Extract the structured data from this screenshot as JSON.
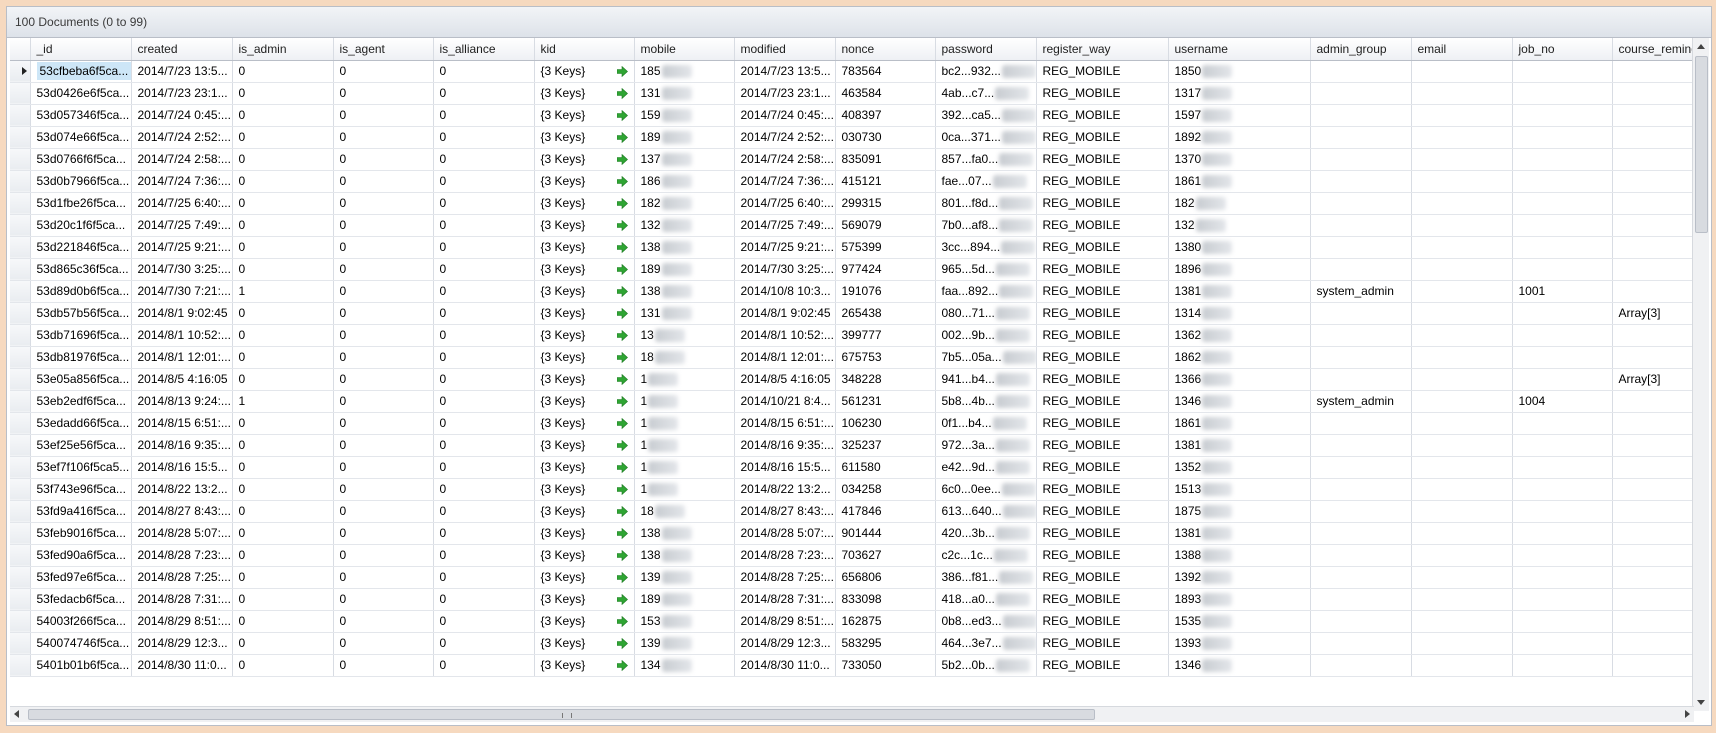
{
  "window": {
    "title": "100 Documents (0 to 99)"
  },
  "columns": [
    "_id",
    "created",
    "is_admin",
    "is_agent",
    "is_alliance",
    "kid",
    "mobile",
    "modified",
    "nonce",
    "password",
    "register_way",
    "username",
    "admin_group",
    "email",
    "job_no",
    "course_reminde"
  ],
  "rows": [
    {
      "id": "53cfbeba6f5ca...",
      "created": "2014/7/23 13:5...",
      "is_admin": "0",
      "is_agent": "0",
      "is_alliance": "0",
      "kid": "{3 Keys}",
      "mobile": "185",
      "modified": "2014/7/23 13:5...",
      "nonce": "783564",
      "password": "bc2...932...",
      "register_way": "REG_MOBILE",
      "username": "1850",
      "admin_group": "",
      "email": "",
      "job_no": "",
      "course_reminde": ""
    },
    {
      "id": "53d0426e6f5ca...",
      "created": "2014/7/23 23:1...",
      "is_admin": "0",
      "is_agent": "0",
      "is_alliance": "0",
      "kid": "{3 Keys}",
      "mobile": "131",
      "modified": "2014/7/23 23:1...",
      "nonce": "463584",
      "password": "4ab...c7...",
      "register_way": "REG_MOBILE",
      "username": "1317",
      "admin_group": "",
      "email": "",
      "job_no": "",
      "course_reminde": ""
    },
    {
      "id": "53d057346f5ca...",
      "created": "2014/7/24 0:45:...",
      "is_admin": "0",
      "is_agent": "0",
      "is_alliance": "0",
      "kid": "{3 Keys}",
      "mobile": "159",
      "modified": "2014/7/24 0:45:...",
      "nonce": "408397",
      "password": "392...ca5...",
      "register_way": "REG_MOBILE",
      "username": "1597",
      "admin_group": "",
      "email": "",
      "job_no": "",
      "course_reminde": ""
    },
    {
      "id": "53d074e66f5ca...",
      "created": "2014/7/24 2:52:...",
      "is_admin": "0",
      "is_agent": "0",
      "is_alliance": "0",
      "kid": "{3 Keys}",
      "mobile": "189",
      "modified": "2014/7/24 2:52:...",
      "nonce": "030730",
      "password": "0ca...371...",
      "register_way": "REG_MOBILE",
      "username": "1892",
      "admin_group": "",
      "email": "",
      "job_no": "",
      "course_reminde": ""
    },
    {
      "id": "53d0766f6f5ca...",
      "created": "2014/7/24 2:58:...",
      "is_admin": "0",
      "is_agent": "0",
      "is_alliance": "0",
      "kid": "{3 Keys}",
      "mobile": "137",
      "modified": "2014/7/24 2:58:...",
      "nonce": "835091",
      "password": "857...fa0...",
      "register_way": "REG_MOBILE",
      "username": "1370",
      "admin_group": "",
      "email": "",
      "job_no": "",
      "course_reminde": ""
    },
    {
      "id": "53d0b7966f5ca...",
      "created": "2014/7/24 7:36:...",
      "is_admin": "0",
      "is_agent": "0",
      "is_alliance": "0",
      "kid": "{3 Keys}",
      "mobile": "186",
      "modified": "2014/7/24 7:36:...",
      "nonce": "415121",
      "password": "fae...07...",
      "register_way": "REG_MOBILE",
      "username": "1861",
      "admin_group": "",
      "email": "",
      "job_no": "",
      "course_reminde": ""
    },
    {
      "id": "53d1fbe26f5ca...",
      "created": "2014/7/25 6:40:...",
      "is_admin": "0",
      "is_agent": "0",
      "is_alliance": "0",
      "kid": "{3 Keys}",
      "mobile": "182",
      "modified": "2014/7/25 6:40:...",
      "nonce": "299315",
      "password": "801...f8d...",
      "register_way": "REG_MOBILE",
      "username": "182",
      "admin_group": "",
      "email": "",
      "job_no": "",
      "course_reminde": ""
    },
    {
      "id": "53d20c1f6f5ca...",
      "created": "2014/7/25 7:49:...",
      "is_admin": "0",
      "is_agent": "0",
      "is_alliance": "0",
      "kid": "{3 Keys}",
      "mobile": "132",
      "modified": "2014/7/25 7:49:...",
      "nonce": "569079",
      "password": "7b0...af8...",
      "register_way": "REG_MOBILE",
      "username": "132",
      "admin_group": "",
      "email": "",
      "job_no": "",
      "course_reminde": ""
    },
    {
      "id": "53d221846f5ca...",
      "created": "2014/7/25 9:21:...",
      "is_admin": "0",
      "is_agent": "0",
      "is_alliance": "0",
      "kid": "{3 Keys}",
      "mobile": "138",
      "modified": "2014/7/25 9:21:...",
      "nonce": "575399",
      "password": "3cc...894...",
      "register_way": "REG_MOBILE",
      "username": "1380",
      "admin_group": "",
      "email": "",
      "job_no": "",
      "course_reminde": ""
    },
    {
      "id": "53d865c36f5ca...",
      "created": "2014/7/30 3:25:...",
      "is_admin": "0",
      "is_agent": "0",
      "is_alliance": "0",
      "kid": "{3 Keys}",
      "mobile": "189",
      "modified": "2014/7/30 3:25:...",
      "nonce": "977424",
      "password": "965...5d...",
      "register_way": "REG_MOBILE",
      "username": "1896",
      "admin_group": "",
      "email": "",
      "job_no": "",
      "course_reminde": ""
    },
    {
      "id": "53d89d0b6f5ca...",
      "created": "2014/7/30 7:21:...",
      "is_admin": "1",
      "is_agent": "0",
      "is_alliance": "0",
      "kid": "{3 Keys}",
      "mobile": "138",
      "modified": "2014/10/8 10:3...",
      "nonce": "191076",
      "password": "faa...892...",
      "register_way": "REG_MOBILE",
      "username": "1381",
      "admin_group": "system_admin",
      "email": "",
      "job_no": "1001",
      "course_reminde": ""
    },
    {
      "id": "53db57b56f5ca...",
      "created": "2014/8/1 9:02:45",
      "is_admin": "0",
      "is_agent": "0",
      "is_alliance": "0",
      "kid": "{3 Keys}",
      "mobile": "131",
      "modified": "2014/8/1 9:02:45",
      "nonce": "265438",
      "password": "080...71...",
      "register_way": "REG_MOBILE",
      "username": "1314",
      "admin_group": "",
      "email": "",
      "job_no": "",
      "course_reminde": "Array[3]"
    },
    {
      "id": "53db71696f5ca...",
      "created": "2014/8/1 10:52:...",
      "is_admin": "0",
      "is_agent": "0",
      "is_alliance": "0",
      "kid": "{3 Keys}",
      "mobile": "13",
      "modified": "2014/8/1 10:52:...",
      "nonce": "399777",
      "password": "002...9b...",
      "register_way": "REG_MOBILE",
      "username": "1362",
      "admin_group": "",
      "email": "",
      "job_no": "",
      "course_reminde": ""
    },
    {
      "id": "53db81976f5ca...",
      "created": "2014/8/1 12:01:...",
      "is_admin": "0",
      "is_agent": "0",
      "is_alliance": "0",
      "kid": "{3 Keys}",
      "mobile": "18",
      "modified": "2014/8/1 12:01:...",
      "nonce": "675753",
      "password": "7b5...05a...",
      "register_way": "REG_MOBILE",
      "username": "1862",
      "admin_group": "",
      "email": "",
      "job_no": "",
      "course_reminde": ""
    },
    {
      "id": "53e05a856f5ca...",
      "created": "2014/8/5 4:16:05",
      "is_admin": "0",
      "is_agent": "0",
      "is_alliance": "0",
      "kid": "{3 Keys}",
      "mobile": "1",
      "modified": "2014/8/5 4:16:05",
      "nonce": "348228",
      "password": "941...b4...",
      "register_way": "REG_MOBILE",
      "username": "1366",
      "admin_group": "",
      "email": "",
      "job_no": "",
      "course_reminde": "Array[3]"
    },
    {
      "id": "53eb2edf6f5ca...",
      "created": "2014/8/13 9:24:...",
      "is_admin": "1",
      "is_agent": "0",
      "is_alliance": "0",
      "kid": "{3 Keys}",
      "mobile": "1",
      "modified": "2014/10/21 8:4...",
      "nonce": "561231",
      "password": "5b8...4b...",
      "register_way": "REG_MOBILE",
      "username": "1346",
      "admin_group": "system_admin",
      "email": "",
      "job_no": "1004",
      "course_reminde": ""
    },
    {
      "id": "53edadd66f5ca...",
      "created": "2014/8/15 6:51:...",
      "is_admin": "0",
      "is_agent": "0",
      "is_alliance": "0",
      "kid": "{3 Keys}",
      "mobile": "1",
      "modified": "2014/8/15 6:51:...",
      "nonce": "106230",
      "password": "0f1...b4...",
      "register_way": "REG_MOBILE",
      "username": "1861",
      "admin_group": "",
      "email": "",
      "job_no": "",
      "course_reminde": ""
    },
    {
      "id": "53ef25e56f5ca...",
      "created": "2014/8/16 9:35:...",
      "is_admin": "0",
      "is_agent": "0",
      "is_alliance": "0",
      "kid": "{3 Keys}",
      "mobile": "1",
      "modified": "2014/8/16 9:35:...",
      "nonce": "325237",
      "password": "972...3a...",
      "register_way": "REG_MOBILE",
      "username": "1381",
      "admin_group": "",
      "email": "",
      "job_no": "",
      "course_reminde": ""
    },
    {
      "id": "53ef7f106f5ca5...",
      "created": "2014/8/16 15:5...",
      "is_admin": "0",
      "is_agent": "0",
      "is_alliance": "0",
      "kid": "{3 Keys}",
      "mobile": "1",
      "modified": "2014/8/16 15:5...",
      "nonce": "611580",
      "password": "e42...9d...",
      "register_way": "REG_MOBILE",
      "username": "1352",
      "admin_group": "",
      "email": "",
      "job_no": "",
      "course_reminde": ""
    },
    {
      "id": "53f743e96f5ca...",
      "created": "2014/8/22 13:2...",
      "is_admin": "0",
      "is_agent": "0",
      "is_alliance": "0",
      "kid": "{3 Keys}",
      "mobile": "1",
      "modified": "2014/8/22 13:2...",
      "nonce": "034258",
      "password": "6c0...0ee...",
      "register_way": "REG_MOBILE",
      "username": "1513",
      "admin_group": "",
      "email": "",
      "job_no": "",
      "course_reminde": ""
    },
    {
      "id": "53fd9a416f5ca...",
      "created": "2014/8/27 8:43:...",
      "is_admin": "0",
      "is_agent": "0",
      "is_alliance": "0",
      "kid": "{3 Keys}",
      "mobile": "18",
      "modified": "2014/8/27 8:43:...",
      "nonce": "417846",
      "password": "613...640...",
      "register_way": "REG_MOBILE",
      "username": "1875",
      "admin_group": "",
      "email": "",
      "job_no": "",
      "course_reminde": ""
    },
    {
      "id": "53feb9016f5ca...",
      "created": "2014/8/28 5:07:...",
      "is_admin": "0",
      "is_agent": "0",
      "is_alliance": "0",
      "kid": "{3 Keys}",
      "mobile": "138",
      "modified": "2014/8/28 5:07:...",
      "nonce": "901444",
      "password": "420...3b...",
      "register_way": "REG_MOBILE",
      "username": "1381",
      "admin_group": "",
      "email": "",
      "job_no": "",
      "course_reminde": ""
    },
    {
      "id": "53fed90a6f5ca...",
      "created": "2014/8/28 7:23:...",
      "is_admin": "0",
      "is_agent": "0",
      "is_alliance": "0",
      "kid": "{3 Keys}",
      "mobile": "138",
      "modified": "2014/8/28 7:23:...",
      "nonce": "703627",
      "password": "c2c...1c...",
      "register_way": "REG_MOBILE",
      "username": "1388",
      "admin_group": "",
      "email": "",
      "job_no": "",
      "course_reminde": ""
    },
    {
      "id": "53fed97e6f5ca...",
      "created": "2014/8/28 7:25:...",
      "is_admin": "0",
      "is_agent": "0",
      "is_alliance": "0",
      "kid": "{3 Keys}",
      "mobile": "139",
      "modified": "2014/8/28 7:25:...",
      "nonce": "656806",
      "password": "386...f81...",
      "register_way": "REG_MOBILE",
      "username": "1392",
      "admin_group": "",
      "email": "",
      "job_no": "",
      "course_reminde": ""
    },
    {
      "id": "53fedacb6f5ca...",
      "created": "2014/8/28 7:31:...",
      "is_admin": "0",
      "is_agent": "0",
      "is_alliance": "0",
      "kid": "{3 Keys}",
      "mobile": "189",
      "modified": "2014/8/28 7:31:...",
      "nonce": "833098",
      "password": "418...a0...",
      "register_way": "REG_MOBILE",
      "username": "1893",
      "admin_group": "",
      "email": "",
      "job_no": "",
      "course_reminde": ""
    },
    {
      "id": "54003f266f5ca...",
      "created": "2014/8/29 8:51:...",
      "is_admin": "0",
      "is_agent": "0",
      "is_alliance": "0",
      "kid": "{3 Keys}",
      "mobile": "153",
      "modified": "2014/8/29 8:51:...",
      "nonce": "162875",
      "password": "0b8...ed3...",
      "register_way": "REG_MOBILE",
      "username": "1535",
      "admin_group": "",
      "email": "",
      "job_no": "",
      "course_reminde": ""
    },
    {
      "id": "540074746f5ca...",
      "created": "2014/8/29 12:3...",
      "is_admin": "0",
      "is_agent": "0",
      "is_alliance": "0",
      "kid": "{3 Keys}",
      "mobile": "139",
      "modified": "2014/8/29 12:3...",
      "nonce": "583295",
      "password": "464...3e7...",
      "register_way": "REG_MOBILE",
      "username": "1393",
      "admin_group": "",
      "email": "",
      "job_no": "",
      "course_reminde": ""
    },
    {
      "id": "5401b01b6f5ca...",
      "created": "2014/8/30 11:0...",
      "is_admin": "0",
      "is_agent": "0",
      "is_alliance": "0",
      "kid": "{3 Keys}",
      "mobile": "134",
      "modified": "2014/8/30 11:0...",
      "nonce": "733050",
      "password": "5b2...0b...",
      "register_way": "REG_MOBILE",
      "username": "1346",
      "admin_group": "",
      "email": "",
      "job_no": "",
      "course_reminde": ""
    }
  ],
  "colors": {
    "selection": "#cde6f7",
    "go_icon": "#2fa533",
    "frame_bg": "#f6d9bf"
  },
  "icons": {
    "row_indicator": "triangle-right-icon",
    "kid_expand": "go-arrow-icon"
  }
}
